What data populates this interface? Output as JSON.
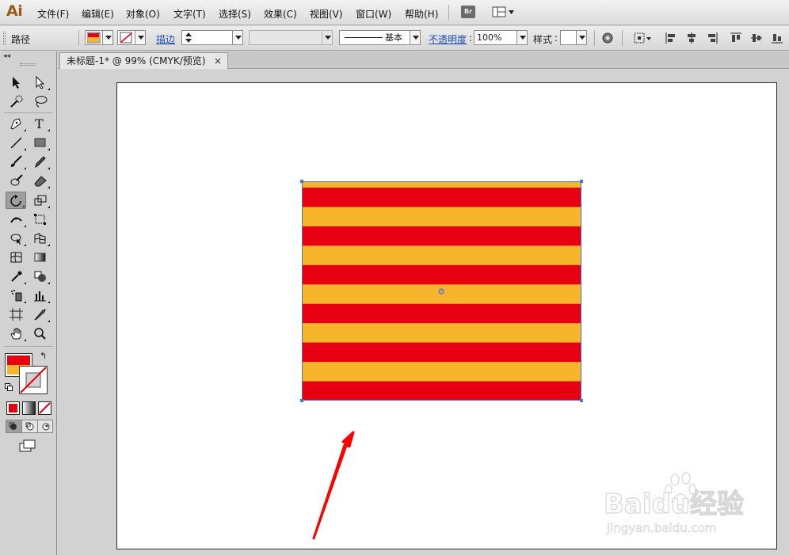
{
  "app": {
    "logo": "Ai"
  },
  "menu": {
    "items": [
      {
        "label": "文件(F)"
      },
      {
        "label": "编辑(E)"
      },
      {
        "label": "对象(O)"
      },
      {
        "label": "文字(T)"
      },
      {
        "label": "选择(S)"
      },
      {
        "label": "效果(C)"
      },
      {
        "label": "视图(V)"
      },
      {
        "label": "窗口(W)"
      },
      {
        "label": "帮助(H)"
      }
    ],
    "bridge_label": "Br"
  },
  "control_bar": {
    "selection_type": "路径",
    "stroke_label": "描边",
    "stroke_style_label": "基本",
    "opacity_label": "不透明度",
    "opacity_value": "100%",
    "style_label": "样式"
  },
  "document": {
    "tab_title": "未标题-1* @ 99% (CMYK/预览)",
    "close_glyph": "×"
  },
  "tools": {
    "active": "rotate-tool"
  },
  "artwork": {
    "stripe_count": 11,
    "colors": {
      "red": "#e60012",
      "yellow": "#f7b52c",
      "selection": "#4a78c8",
      "arrow": "#ff0000"
    }
  },
  "watermark": {
    "brand": "Baidu经验",
    "url": "jingyan.baidu.com"
  }
}
